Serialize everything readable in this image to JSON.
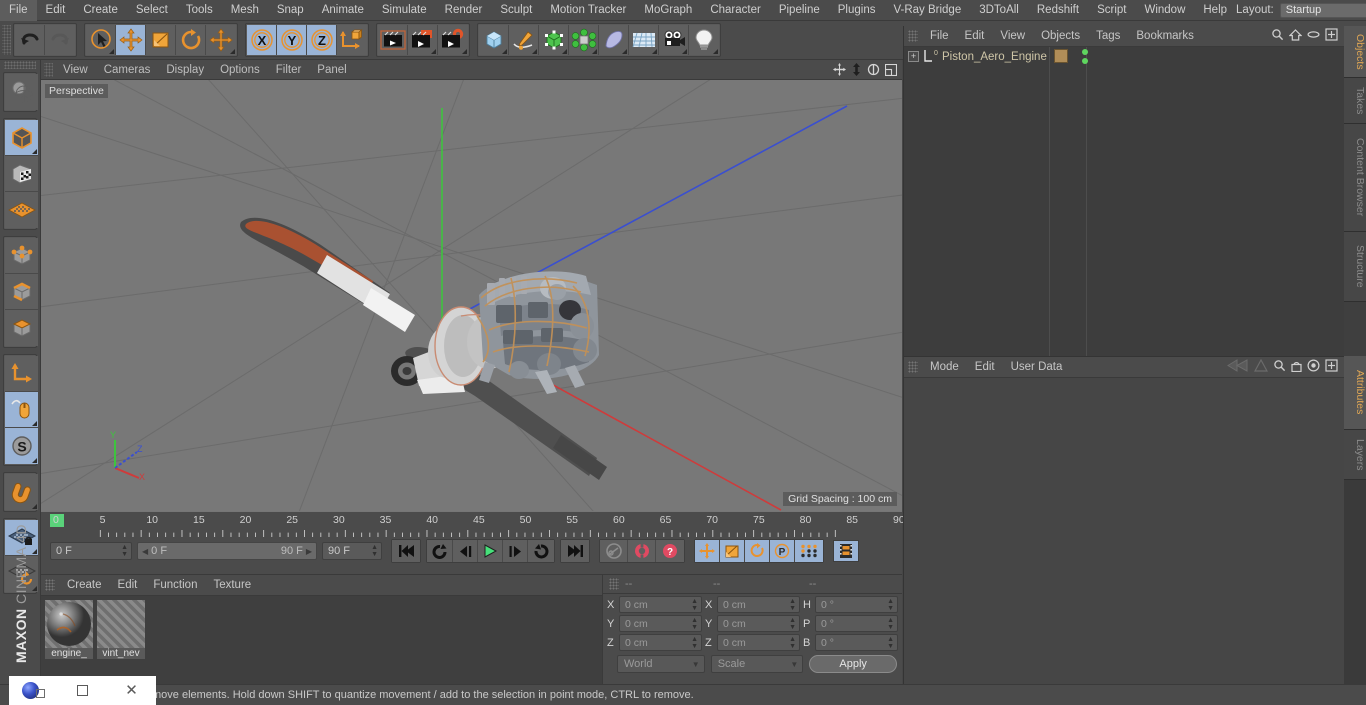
{
  "menubar": {
    "items": [
      "File",
      "Edit",
      "Create",
      "Select",
      "Tools",
      "Mesh",
      "Snap",
      "Animate",
      "Simulate",
      "Render",
      "Sculpt",
      "Motion Tracker",
      "MoGraph",
      "Character",
      "Pipeline",
      "Plugins",
      "V-Ray Bridge",
      "3DToAll",
      "Redshift",
      "Script",
      "Window",
      "Help"
    ],
    "layout_label": "Layout:",
    "layout_value": "Startup",
    "search_icon": "magnifier-icon",
    "home_icon": "home-icon",
    "minimize_icon": "minimize-icon",
    "maximize_icon": "maximize-icon"
  },
  "toolbar": {
    "groups": [
      {
        "name": "history",
        "buttons": [
          {
            "icon": "undo-icon",
            "name": "undo-button",
            "active": false
          },
          {
            "icon": "redo-icon",
            "name": "redo-button",
            "active": false
          }
        ]
      },
      {
        "name": "tools",
        "buttons": [
          {
            "icon": "live-selection-icon",
            "name": "live-selection-tool",
            "active": false
          },
          {
            "icon": "move-icon",
            "name": "move-tool",
            "active": true
          },
          {
            "icon": "scale-icon",
            "name": "scale-tool",
            "active": false
          },
          {
            "icon": "rotate-icon",
            "name": "rotate-tool",
            "active": false
          },
          {
            "icon": "move-icon",
            "name": "move-duplicate-tool",
            "active": false
          }
        ]
      },
      {
        "name": "axis-locks",
        "buttons": [
          {
            "icon": "x-axis-icon",
            "name": "x-axis-lock",
            "active": true
          },
          {
            "icon": "y-axis-icon",
            "name": "y-axis-lock",
            "active": true
          },
          {
            "icon": "z-axis-icon",
            "name": "z-axis-lock",
            "active": true
          },
          {
            "icon": "world-object-axis-icon",
            "name": "world-object-toggle",
            "active": false
          }
        ]
      },
      {
        "name": "render",
        "buttons": [
          {
            "icon": "render-view-icon",
            "name": "render-view-button",
            "active": false
          },
          {
            "icon": "render-region-icon",
            "name": "render-to-picture-viewer-button",
            "active": false
          },
          {
            "icon": "render-settings-icon",
            "name": "render-settings-button",
            "active": false
          }
        ]
      },
      {
        "name": "create",
        "buttons": [
          {
            "icon": "cube-icon",
            "name": "add-cube-object",
            "active": false
          },
          {
            "icon": "pen-icon",
            "name": "add-spline-object",
            "active": false
          },
          {
            "icon": "nurbs-icon",
            "name": "add-generator-object",
            "active": false
          },
          {
            "icon": "array-icon",
            "name": "add-modeling-object",
            "active": false
          },
          {
            "icon": "bend-icon",
            "name": "add-deformer-object",
            "active": false
          },
          {
            "icon": "floor-icon",
            "name": "add-scene-object",
            "active": false
          },
          {
            "icon": "camera-icon",
            "name": "add-camera-object",
            "active": false
          },
          {
            "icon": "light-icon",
            "name": "add-light-object",
            "active": false
          }
        ]
      }
    ]
  },
  "leftbar": {
    "groups": [
      [
        {
          "icon": "undo-view-icon",
          "name": "undo-view-button",
          "active": false
        }
      ],
      [
        {
          "icon": "model-mode-icon",
          "name": "model-mode-button",
          "active": true
        },
        {
          "icon": "texture-mode-icon",
          "name": "texture-mode-button",
          "active": false
        },
        {
          "icon": "workplane-icon",
          "name": "workplane-button",
          "active": false
        }
      ],
      [
        {
          "icon": "points-mode-icon",
          "name": "points-mode-button",
          "active": false
        },
        {
          "icon": "edges-mode-icon",
          "name": "edges-mode-button",
          "active": false
        },
        {
          "icon": "polygons-mode-icon",
          "name": "polygons-mode-button",
          "active": false
        }
      ],
      [
        {
          "icon": "axis-modify-icon",
          "name": "enable-axis-button",
          "active": false
        },
        {
          "icon": "viewport-solo-icon",
          "name": "viewport-solo-button",
          "active": true
        },
        {
          "icon": "soft-selection-icon",
          "name": "soft-selection-button",
          "active": true
        }
      ],
      [
        {
          "icon": "magnet-icon",
          "name": "magnet-tool-button",
          "active": false
        }
      ],
      [
        {
          "icon": "lock-workplane-icon",
          "name": "lock-workplane-button",
          "active": true
        },
        {
          "icon": "planar-workplane-icon",
          "name": "planar-workplane-button",
          "active": false
        }
      ]
    ],
    "brand_main": "MAXON",
    "brand_sub": "CINEMA 4D"
  },
  "viewport": {
    "menu": [
      "View",
      "Cameras",
      "Display",
      "Filter",
      "Panel"
    ],
    "menu_full": [
      "View",
      "Cameras",
      "Display",
      "Options",
      "Filter",
      "Panel"
    ],
    "label": "Perspective",
    "grid_spacing": "Grid Spacing : 100 cm",
    "icons": [
      "move-camera-icon",
      "dolly-camera-icon",
      "rotate-camera-icon",
      "maximize-viewport-icon"
    ],
    "axis_x": "X",
    "axis_y": "Y",
    "axis_z": "Z",
    "scene_description": "Piston aero engine with propeller on perspective grid"
  },
  "timeline": {
    "ticks": [
      "0",
      "5",
      "10",
      "15",
      "20",
      "25",
      "30",
      "35",
      "40",
      "45",
      "50",
      "55",
      "60",
      "65",
      "70",
      "75",
      "80",
      "85",
      "90"
    ],
    "current_frame": "0 F",
    "preview_start": "0 F",
    "preview_end": "90 F",
    "max_frame": "90 F",
    "frame_field_right": "0 F",
    "transport": [
      {
        "icon": "go-to-start-icon",
        "name": "go-to-start-button",
        "active": false
      },
      {
        "icon": "play-backwards-loop-icon",
        "name": "play-backwards-button",
        "active": false
      },
      {
        "icon": "previous-frame-icon",
        "name": "previous-frame-button",
        "active": false
      },
      {
        "icon": "play-forward-icon",
        "name": "play-button",
        "active": false
      },
      {
        "icon": "next-frame-icon",
        "name": "next-frame-button",
        "active": false
      },
      {
        "icon": "play-loop-icon",
        "name": "loop-button",
        "active": false
      },
      {
        "icon": "go-to-end-icon",
        "name": "go-to-end-button",
        "active": false
      }
    ],
    "keyframe_tools": [
      {
        "icon": "record-key-disabled-icon",
        "name": "autokeying-button",
        "active": false
      },
      {
        "icon": "record-active-objects-icon",
        "name": "record-active-objects-button",
        "active": false
      },
      {
        "icon": "keyframe-selection-icon",
        "name": "keyframe-selection-button",
        "active": false
      }
    ],
    "key_toggles": [
      {
        "icon": "position-key-icon",
        "name": "position-key-toggle",
        "active": true
      },
      {
        "icon": "scale-key-icon",
        "name": "scale-key-toggle",
        "active": true
      },
      {
        "icon": "rotation-key-icon",
        "name": "rotation-key-toggle",
        "active": true
      },
      {
        "icon": "parameter-key-icon",
        "name": "parameter-key-toggle",
        "active": true
      },
      {
        "icon": "point-level-animation-icon",
        "name": "pla-toggle",
        "active": true
      }
    ],
    "timeline_toggle": {
      "icon": "film-strip-icon",
      "name": "timeline-toggle",
      "active": true
    }
  },
  "material_manager": {
    "menu": [
      "Create",
      "Edit",
      "Function",
      "Texture"
    ],
    "materials": [
      {
        "name": "engine_",
        "type": "shaded-sphere"
      },
      {
        "name": "vint_nev",
        "type": "empty-slot"
      }
    ]
  },
  "coordinates": {
    "header_dashes": [
      "--",
      "--",
      "--"
    ],
    "rows": [
      {
        "label": "X",
        "position": "0 cm",
        "label2": "X",
        "size": "0 cm",
        "label3": "H",
        "rot": "0 °"
      },
      {
        "label": "Y",
        "position": "0 cm",
        "label2": "Y",
        "size": "0 cm",
        "label3": "P",
        "rot": "0 °"
      },
      {
        "label": "Z",
        "position": "0 cm",
        "label2": "Z",
        "size": "0 cm",
        "label3": "B",
        "rot": "0 °"
      }
    ],
    "coord_system": "World",
    "mode": "Scale",
    "apply_label": "Apply"
  },
  "object_manager": {
    "menu": [
      "File",
      "Edit",
      "View",
      "Objects",
      "Tags",
      "Bookmarks"
    ],
    "icons": [
      "magnifier-icon",
      "home-icon",
      "ellipse-icon",
      "new-tab-icon"
    ],
    "objects": [
      {
        "name": "Piston_Aero_Engine",
        "layer": "0",
        "expandable": true,
        "tag": "material-tag",
        "visibility_top": "green",
        "visibility_bottom": "green"
      }
    ]
  },
  "attribute_manager": {
    "menu": [
      "Mode",
      "Edit",
      "User Data"
    ],
    "icons": [
      "history-back-icon",
      "pin-icon",
      "magnifier-icon",
      "lock-icon",
      "target-icon",
      "new-tab-icon"
    ]
  },
  "vertical_tabs": [
    {
      "label": "Objects",
      "active": true
    },
    {
      "label": "Takes",
      "active": false
    },
    {
      "label": "Content Browser",
      "active": false
    },
    {
      "label": "Structure",
      "active": false
    },
    {
      "label": "Attributes",
      "active": true
    },
    {
      "label": "Layers",
      "active": false
    }
  ],
  "statusbar": {
    "text": "move elements. Hold down SHIFT to quantize movement / add to the selection in point mode, CTRL to remove."
  },
  "window_overlay": {
    "app_icon": "cinema4d-icon",
    "restore_icon": "restore-window-icon",
    "maximize_icon": "maximize-window-icon",
    "close_icon": "close-window-icon"
  },
  "colors": {
    "bg": "#464646",
    "panel": "#4b4b4b",
    "viewport": "#767676",
    "accent_orange": "#e8922e",
    "active_blue": "#9ab4d6",
    "axis_x": "#d23b3b",
    "axis_y": "#3ec43e",
    "axis_z": "#4060d8",
    "tab_active": "#e0a755",
    "object_name": "#cfc6a8"
  }
}
